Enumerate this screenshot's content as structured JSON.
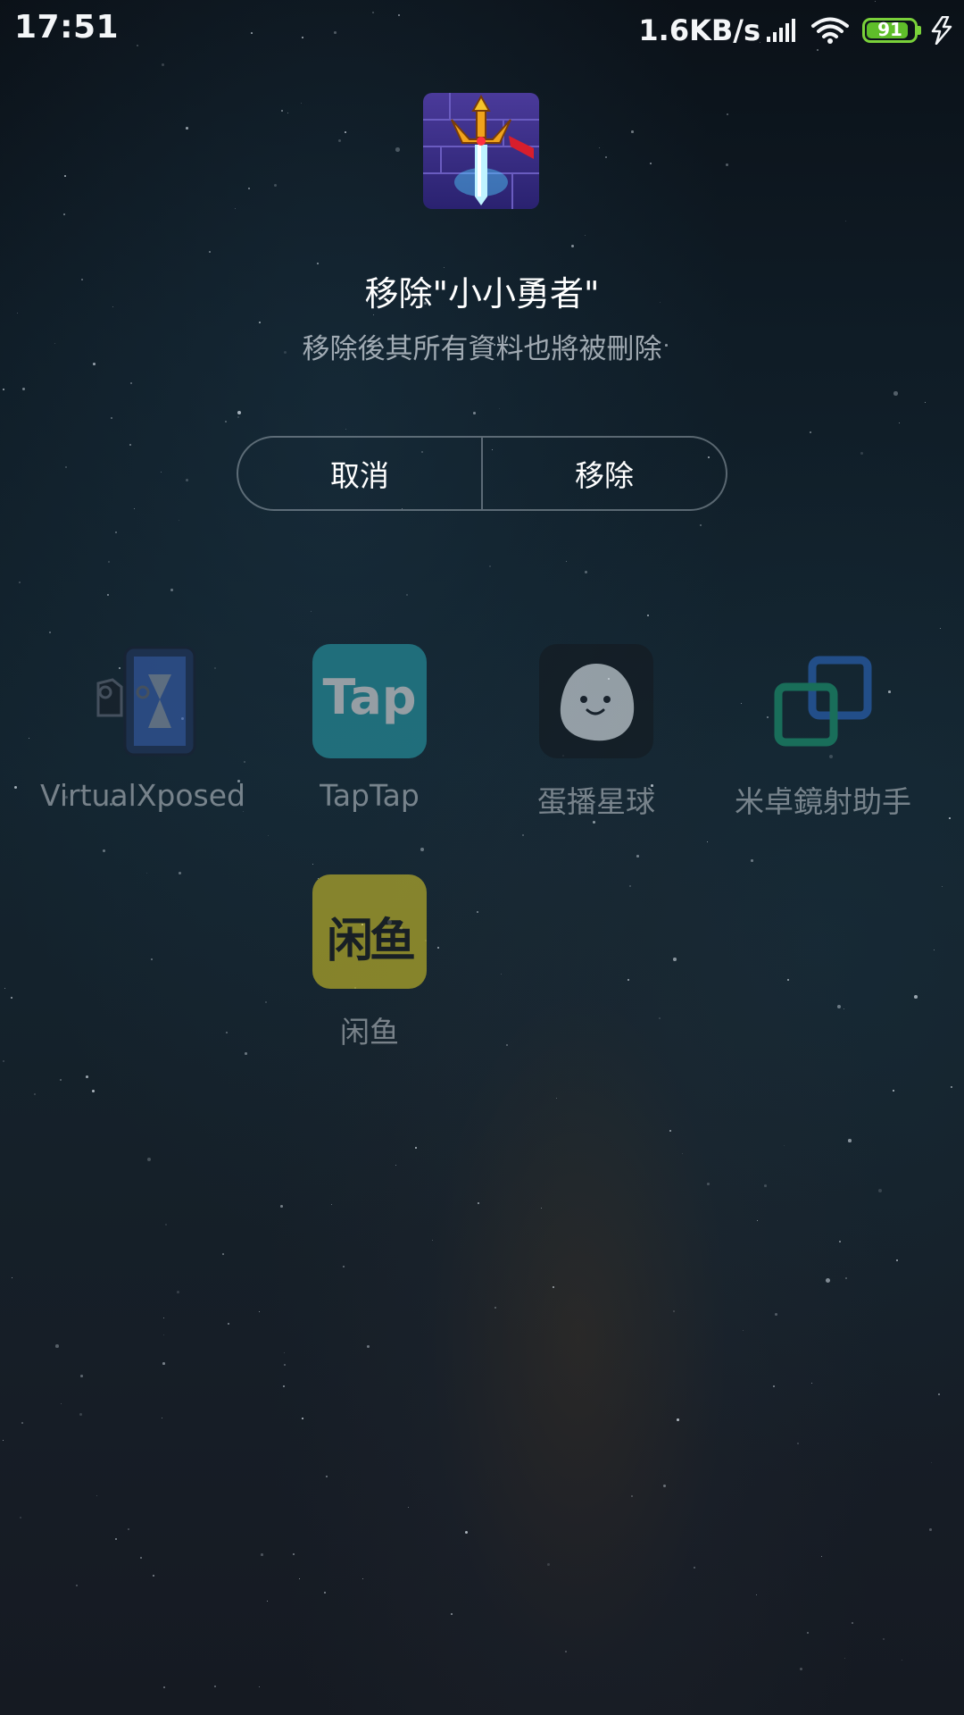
{
  "status_bar": {
    "time": "17:51",
    "network_speed": "1.6KB/s",
    "battery_level": "91",
    "icons": [
      "signal-icon",
      "wifi-icon",
      "battery-icon",
      "charging-icon"
    ]
  },
  "dialog": {
    "app_icon": "sword-game-icon",
    "title": "移除\"小小勇者\"",
    "message": "移除後其所有資料也將被刪除",
    "cancel_label": "取消",
    "confirm_label": "移除"
  },
  "apps": [
    {
      "label": "VirtualXposed",
      "icon": "virtualxposed-icon"
    },
    {
      "label": "TapTap",
      "icon": "taptap-icon",
      "icon_text": "Tap"
    },
    {
      "label": "蛋播星球",
      "icon": "egg-planet-icon"
    },
    {
      "label": "米卓鏡射助手",
      "icon": "mirror-assistant-icon"
    },
    {
      "label": "闲鱼",
      "icon": "xianyu-icon",
      "icon_text": "闲鱼"
    }
  ],
  "colors": {
    "battery": "#7ad13a",
    "taptap": "#2aa8b5",
    "xianyu": "#f5e127"
  }
}
